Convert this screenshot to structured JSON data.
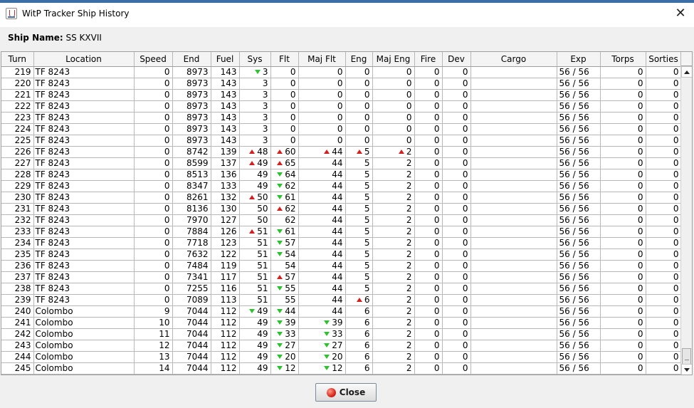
{
  "window": {
    "title": "WitP Tracker Ship History",
    "close_symbol": "✕",
    "icon": "java-cup-icon"
  },
  "ship": {
    "label": "Ship Name:",
    "name": "SS KXVII"
  },
  "table": {
    "columns": [
      "Turn",
      "Location",
      "Speed",
      "End",
      "Fuel",
      "Sys",
      "Flt",
      "Maj Flt",
      "Eng",
      "Maj Eng",
      "Fire",
      "Dev",
      "Cargo",
      "Exp",
      "Torps",
      "Sorties"
    ],
    "rows": [
      [
        "219",
        "TF 8243",
        "0",
        "8973",
        "143",
        "3",
        "0",
        "0",
        "0",
        "0",
        "0",
        "0",
        "",
        "56 / 56",
        "0",
        "0"
      ],
      [
        "220",
        "TF 8243",
        "0",
        "8973",
        "143",
        "3",
        "0",
        "0",
        "0",
        "0",
        "0",
        "0",
        "",
        "56 / 56",
        "0",
        "0"
      ],
      [
        "221",
        "TF 8243",
        "0",
        "8973",
        "143",
        "3",
        "0",
        "0",
        "0",
        "0",
        "0",
        "0",
        "",
        "56 / 56",
        "0",
        "0"
      ],
      [
        "222",
        "TF 8243",
        "0",
        "8973",
        "143",
        "3",
        "0",
        "0",
        "0",
        "0",
        "0",
        "0",
        "",
        "56 / 56",
        "0",
        "0"
      ],
      [
        "223",
        "TF 8243",
        "0",
        "8973",
        "143",
        "3",
        "0",
        "0",
        "0",
        "0",
        "0",
        "0",
        "",
        "56 / 56",
        "0",
        "0"
      ],
      [
        "224",
        "TF 8243",
        "0",
        "8973",
        "143",
        "3",
        "0",
        "0",
        "0",
        "0",
        "0",
        "0",
        "",
        "56 / 56",
        "0",
        "0"
      ],
      [
        "225",
        "TF 8243",
        "0",
        "8973",
        "143",
        "3",
        "0",
        "0",
        "0",
        "0",
        "0",
        "0",
        "",
        "56 / 56",
        "0",
        "0"
      ],
      [
        "226",
        "TF 8243",
        "0",
        "8742",
        "139",
        "48",
        "60",
        "44",
        "5",
        "2",
        "0",
        "0",
        "",
        "56 / 56",
        "0",
        "0"
      ],
      [
        "227",
        "TF 8243",
        "0",
        "8599",
        "137",
        "49",
        "65",
        "44",
        "5",
        "2",
        "0",
        "0",
        "",
        "56 / 56",
        "0",
        "0"
      ],
      [
        "228",
        "TF 8243",
        "0",
        "8513",
        "136",
        "49",
        "64",
        "44",
        "5",
        "2",
        "0",
        "0",
        "",
        "56 / 56",
        "0",
        "0"
      ],
      [
        "229",
        "TF 8243",
        "0",
        "8347",
        "133",
        "49",
        "62",
        "44",
        "5",
        "2",
        "0",
        "0",
        "",
        "56 / 56",
        "0",
        "0"
      ],
      [
        "230",
        "TF 8243",
        "0",
        "8261",
        "132",
        "50",
        "61",
        "44",
        "5",
        "2",
        "0",
        "0",
        "",
        "56 / 56",
        "0",
        "0"
      ],
      [
        "231",
        "TF 8243",
        "0",
        "8136",
        "130",
        "50",
        "62",
        "44",
        "5",
        "2",
        "0",
        "0",
        "",
        "56 / 56",
        "0",
        "0"
      ],
      [
        "232",
        "TF 8243",
        "0",
        "7970",
        "127",
        "50",
        "62",
        "44",
        "5",
        "2",
        "0",
        "0",
        "",
        "56 / 56",
        "0",
        "0"
      ],
      [
        "233",
        "TF 8243",
        "0",
        "7884",
        "126",
        "51",
        "61",
        "44",
        "5",
        "2",
        "0",
        "0",
        "",
        "56 / 56",
        "0",
        "0"
      ],
      [
        "234",
        "TF 8243",
        "0",
        "7718",
        "123",
        "51",
        "57",
        "44",
        "5",
        "2",
        "0",
        "0",
        "",
        "56 / 56",
        "0",
        "0"
      ],
      [
        "235",
        "TF 8243",
        "0",
        "7632",
        "122",
        "51",
        "54",
        "44",
        "5",
        "2",
        "0",
        "0",
        "",
        "56 / 56",
        "0",
        "0"
      ],
      [
        "236",
        "TF 8243",
        "0",
        "7484",
        "119",
        "51",
        "54",
        "44",
        "5",
        "2",
        "0",
        "0",
        "",
        "56 / 56",
        "0",
        "0"
      ],
      [
        "237",
        "TF 8243",
        "0",
        "7341",
        "117",
        "51",
        "57",
        "44",
        "5",
        "2",
        "0",
        "0",
        "",
        "56 / 56",
        "0",
        "0"
      ],
      [
        "238",
        "TF 8243",
        "0",
        "7255",
        "116",
        "51",
        "55",
        "44",
        "5",
        "2",
        "0",
        "0",
        "",
        "56 / 56",
        "0",
        "0"
      ],
      [
        "239",
        "TF 8243",
        "0",
        "7089",
        "113",
        "51",
        "55",
        "44",
        "6",
        "2",
        "0",
        "0",
        "",
        "56 / 56",
        "0",
        "0"
      ],
      [
        "240",
        "Colombo",
        "9",
        "7044",
        "112",
        "49",
        "44",
        "44",
        "6",
        "2",
        "0",
        "0",
        "",
        "56 / 56",
        "0",
        "0"
      ],
      [
        "241",
        "Colombo",
        "10",
        "7044",
        "112",
        "49",
        "39",
        "39",
        "6",
        "2",
        "0",
        "0",
        "",
        "56 / 56",
        "0",
        "0"
      ],
      [
        "242",
        "Colombo",
        "11",
        "7044",
        "112",
        "49",
        "33",
        "33",
        "6",
        "2",
        "0",
        "0",
        "",
        "56 / 56",
        "0",
        "0"
      ],
      [
        "243",
        "Colombo",
        "12",
        "7044",
        "112",
        "49",
        "27",
        "27",
        "6",
        "2",
        "0",
        "0",
        "",
        "56 / 56",
        "0",
        "0"
      ],
      [
        "244",
        "Colombo",
        "13",
        "7044",
        "112",
        "49",
        "20",
        "20",
        "6",
        "2",
        "0",
        "0",
        "",
        "56 / 56",
        "0",
        "0"
      ],
      [
        "245",
        "Colombo",
        "14",
        "7044",
        "112",
        "49",
        "12",
        "12",
        "6",
        "2",
        "0",
        "0",
        "",
        "56 / 56",
        "0",
        "0"
      ]
    ],
    "trend_markers": [
      {
        "row": 0,
        "col": 5,
        "dir": "down"
      },
      {
        "row": 7,
        "col": 5,
        "dir": "up"
      },
      {
        "row": 7,
        "col": 6,
        "dir": "up"
      },
      {
        "row": 7,
        "col": 7,
        "dir": "up"
      },
      {
        "row": 7,
        "col": 8,
        "dir": "up"
      },
      {
        "row": 7,
        "col": 9,
        "dir": "up"
      },
      {
        "row": 8,
        "col": 5,
        "dir": "up"
      },
      {
        "row": 8,
        "col": 6,
        "dir": "up"
      },
      {
        "row": 9,
        "col": 6,
        "dir": "down"
      },
      {
        "row": 10,
        "col": 6,
        "dir": "down"
      },
      {
        "row": 11,
        "col": 5,
        "dir": "up"
      },
      {
        "row": 11,
        "col": 6,
        "dir": "down"
      },
      {
        "row": 12,
        "col": 6,
        "dir": "up"
      },
      {
        "row": 14,
        "col": 5,
        "dir": "up"
      },
      {
        "row": 14,
        "col": 6,
        "dir": "down"
      },
      {
        "row": 15,
        "col": 6,
        "dir": "down"
      },
      {
        "row": 16,
        "col": 6,
        "dir": "down"
      },
      {
        "row": 18,
        "col": 6,
        "dir": "up"
      },
      {
        "row": 19,
        "col": 6,
        "dir": "down"
      },
      {
        "row": 20,
        "col": 8,
        "dir": "up"
      },
      {
        "row": 21,
        "col": 5,
        "dir": "down"
      },
      {
        "row": 21,
        "col": 6,
        "dir": "down"
      },
      {
        "row": 22,
        "col": 6,
        "dir": "down"
      },
      {
        "row": 22,
        "col": 7,
        "dir": "down"
      },
      {
        "row": 23,
        "col": 6,
        "dir": "down"
      },
      {
        "row": 23,
        "col": 7,
        "dir": "down"
      },
      {
        "row": 24,
        "col": 6,
        "dir": "down"
      },
      {
        "row": 24,
        "col": 7,
        "dir": "down"
      },
      {
        "row": 25,
        "col": 6,
        "dir": "down"
      },
      {
        "row": 25,
        "col": 7,
        "dir": "down"
      },
      {
        "row": 26,
        "col": 6,
        "dir": "down"
      },
      {
        "row": 26,
        "col": 7,
        "dir": "down"
      }
    ],
    "colors": {
      "up": "#d21f1f",
      "down": "#2fbf2f"
    }
  },
  "buttons": {
    "close_label": "Close",
    "close_icon": "red-circle-icon"
  }
}
